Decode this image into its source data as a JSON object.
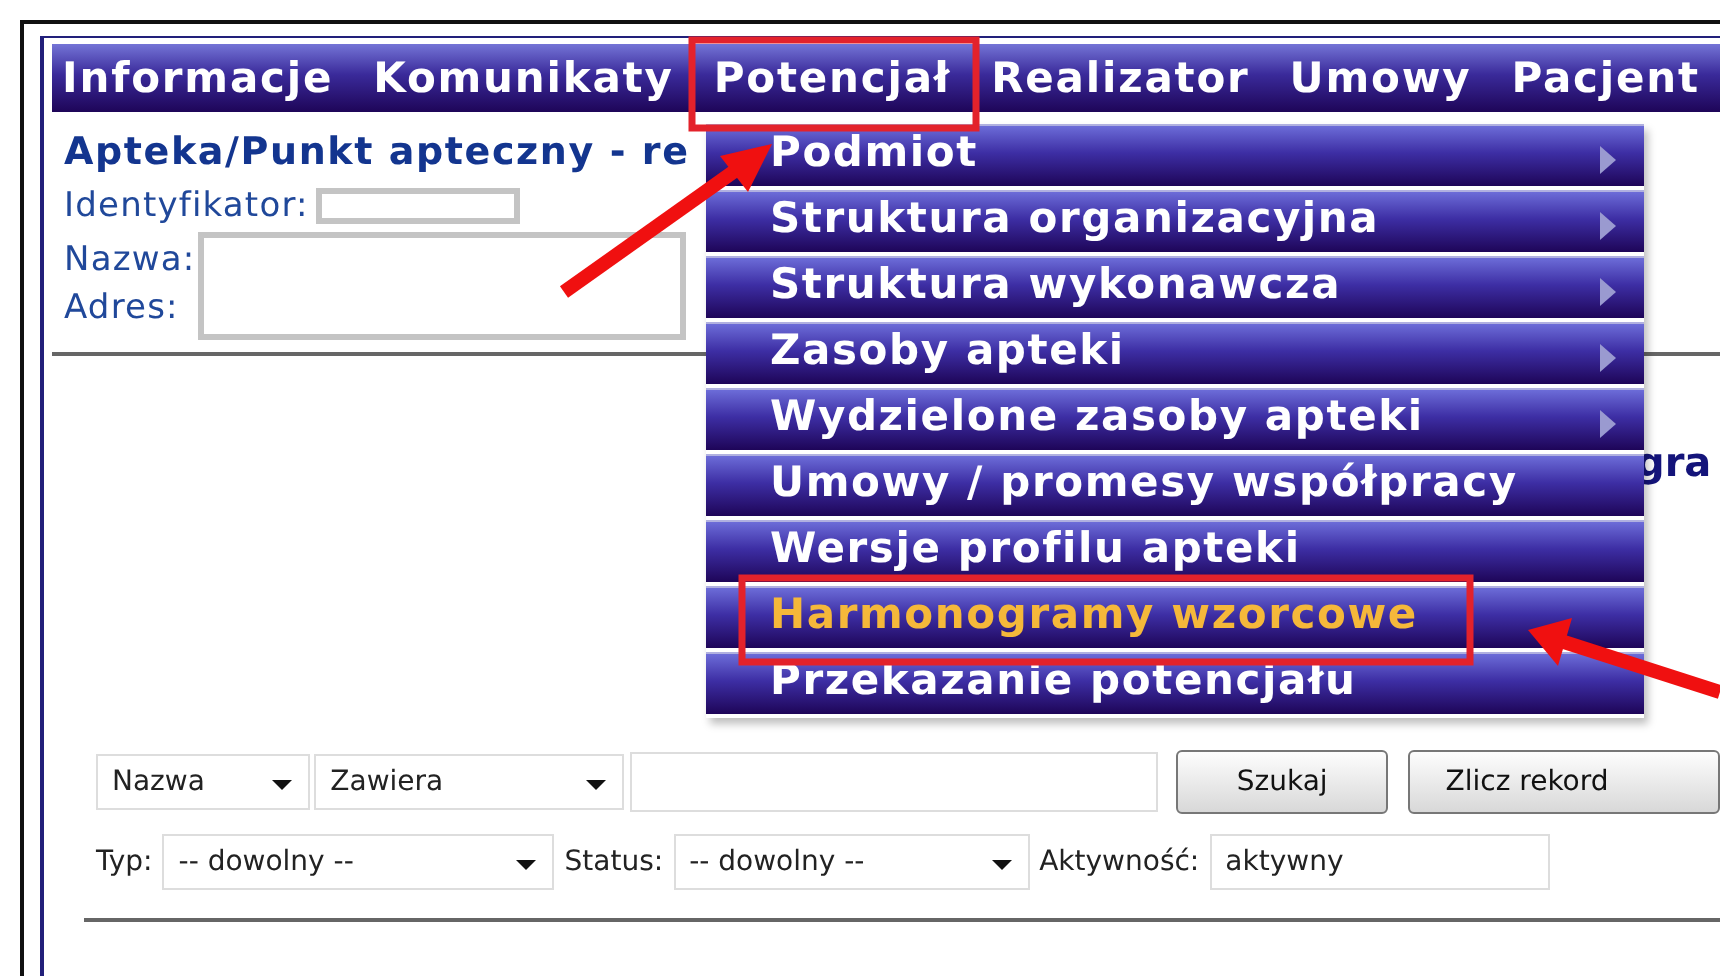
{
  "menu_bar": [
    {
      "label": "Informacje"
    },
    {
      "label": "Komunikaty"
    },
    {
      "label": "Potencjał"
    },
    {
      "label": "Realizator"
    },
    {
      "label": "Umowy"
    },
    {
      "label": "Pacjent"
    }
  ],
  "dropdown": [
    {
      "label": "Podmiot",
      "has_submenu": true,
      "selected": false
    },
    {
      "label": "Struktura organizacyjna",
      "has_submenu": true,
      "selected": false
    },
    {
      "label": "Struktura wykonawcza",
      "has_submenu": true,
      "selected": false
    },
    {
      "label": "Zasoby apteki",
      "has_submenu": true,
      "selected": false
    },
    {
      "label": "Wydzielone zasoby apteki",
      "has_submenu": true,
      "selected": false
    },
    {
      "label": "Umowy / promesy współpracy",
      "has_submenu": false,
      "selected": false
    },
    {
      "label": "Wersje profilu apteki",
      "has_submenu": false,
      "selected": false
    },
    {
      "label": "Harmonogramy wzorcowe",
      "has_submenu": false,
      "selected": true
    },
    {
      "label": "Przekazanie potencjału",
      "has_submenu": false,
      "selected": false
    }
  ],
  "header": {
    "title": "Apteka/Punkt apteczny - re",
    "identifier_label": "Identyfikator:",
    "name_label": "Nazwa:",
    "address_label": "Adres:"
  },
  "section_title": "gra",
  "search": {
    "field": "Nazwa",
    "operator": "Zawiera",
    "search_button": "Szukaj",
    "count_button": "Zlicz rekord"
  },
  "filters": [
    {
      "label": "Typ:",
      "value": "-- dowolny --"
    },
    {
      "label": "Status:",
      "value": "-- dowolny --"
    },
    {
      "label": "Aktywność:",
      "value": "aktywny"
    }
  ]
}
